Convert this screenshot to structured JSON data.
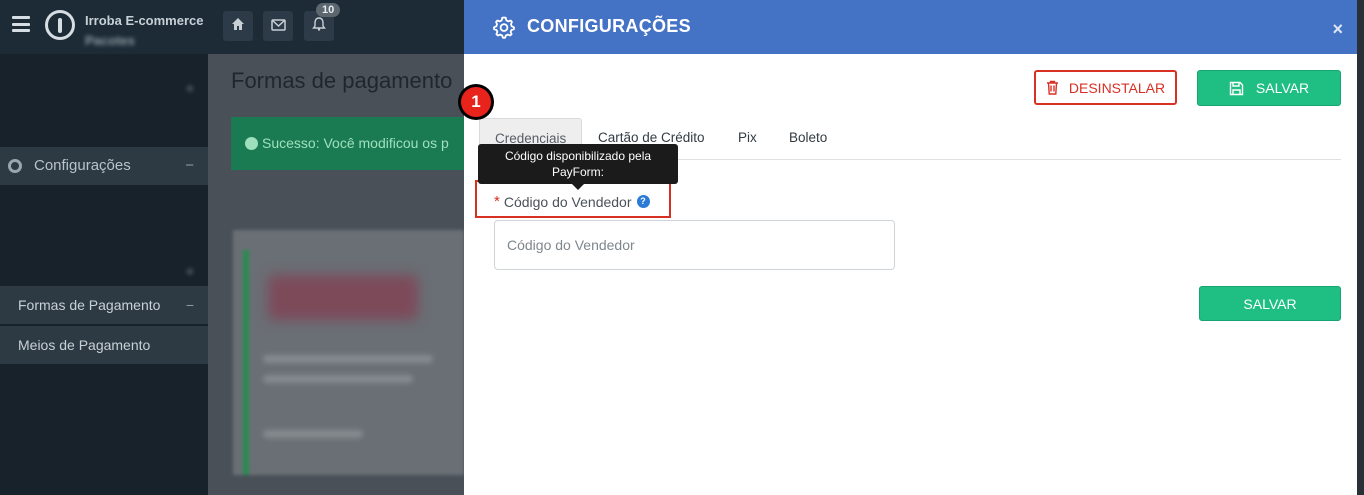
{
  "app": {
    "brand": "Irroba E-commerce",
    "brand_sub": "Pacotes",
    "notification_count": "10"
  },
  "sidebar": {
    "section_label": "Configurações",
    "items": [
      {
        "label": "Formas de Pagamento"
      },
      {
        "label": "Meios de Pagamento"
      }
    ]
  },
  "page": {
    "heading": "Formas de pagamento",
    "success_message": "Sucesso: Você modificou os p"
  },
  "modal": {
    "title": "CONFIGURAÇÕES",
    "close_label": "×",
    "uninstall_label": "DESINSTALAR",
    "save_label": "SALVAR",
    "step_number": "1",
    "tabs": [
      {
        "label": "Credenciais",
        "active": true
      },
      {
        "label": "Cartão de Crédito",
        "active": false
      },
      {
        "label": "Pix",
        "active": false
      },
      {
        "label": "Boleto",
        "active": false
      }
    ],
    "tooltip": "Código disponibilizado pela PayForm:",
    "field": {
      "required_mark": "*",
      "label": "Código do Vendedor",
      "help_icon": "?",
      "placeholder": "Código do Vendedor",
      "value": ""
    },
    "bottom_save_label": "SALVAR"
  },
  "colors": {
    "header_blue": "#4472c4",
    "danger_red": "#d93025",
    "success_green": "#1fbf84"
  },
  "icons": {
    "menu": "hamburger-icon",
    "home": "home-icon",
    "mail": "envelope-icon",
    "notifications": "bell-icon",
    "modal_title": "gear-icon",
    "uninstall": "trash-icon",
    "save": "floppy-disk-icon",
    "help": "question-circle-icon"
  }
}
